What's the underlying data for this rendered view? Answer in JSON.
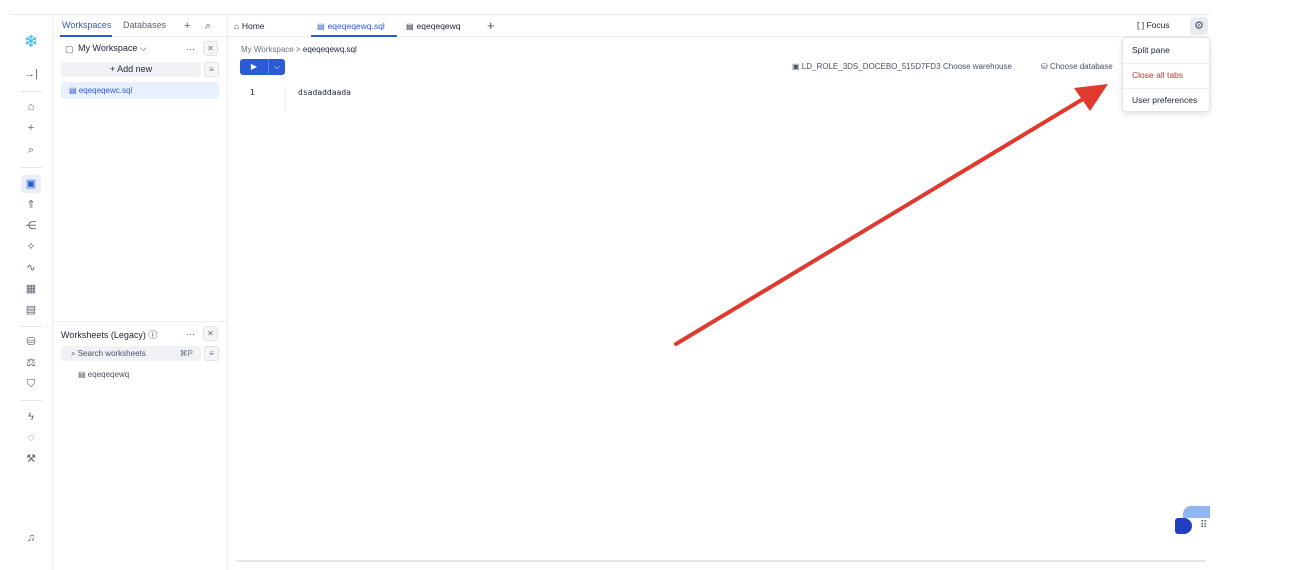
{
  "explorer": {
    "tabs": [
      "Workspaces",
      "Databases"
    ],
    "workspace_title": "My Workspace",
    "add_new": "+ Add new",
    "files": [
      "eqeqeqewc.sql"
    ],
    "legacy_title": "Worksheets (Legacy)",
    "search_placeholder": "Search worksheets",
    "search_shortcut": "⌘P",
    "legacy_items": [
      "eqeqeqewq"
    ]
  },
  "tabs": {
    "home": "Home",
    "sql_tab": "eqeqeqewq.sql",
    "ws_tab": "eqeqeqewq",
    "focus": "Focus"
  },
  "breadcrumb": {
    "parent": "My Workspace",
    "separator": ">",
    "current": "eqeqeqewq.sql"
  },
  "context": {
    "role": "LD_ROLE_3DS_DOCEBO_515D7FD3",
    "warehouse": "Choose warehouse",
    "database": "Choose database"
  },
  "editor": {
    "line_number": "1",
    "code": "dsadaddaada"
  },
  "menu": {
    "items": [
      "Split pane",
      "Close all tabs",
      "User preferences"
    ]
  },
  "colors": {
    "accent": "#2a5bd7",
    "danger": "#c9302c",
    "arrow": "#e03a2f",
    "brand": "#29b5e8"
  }
}
